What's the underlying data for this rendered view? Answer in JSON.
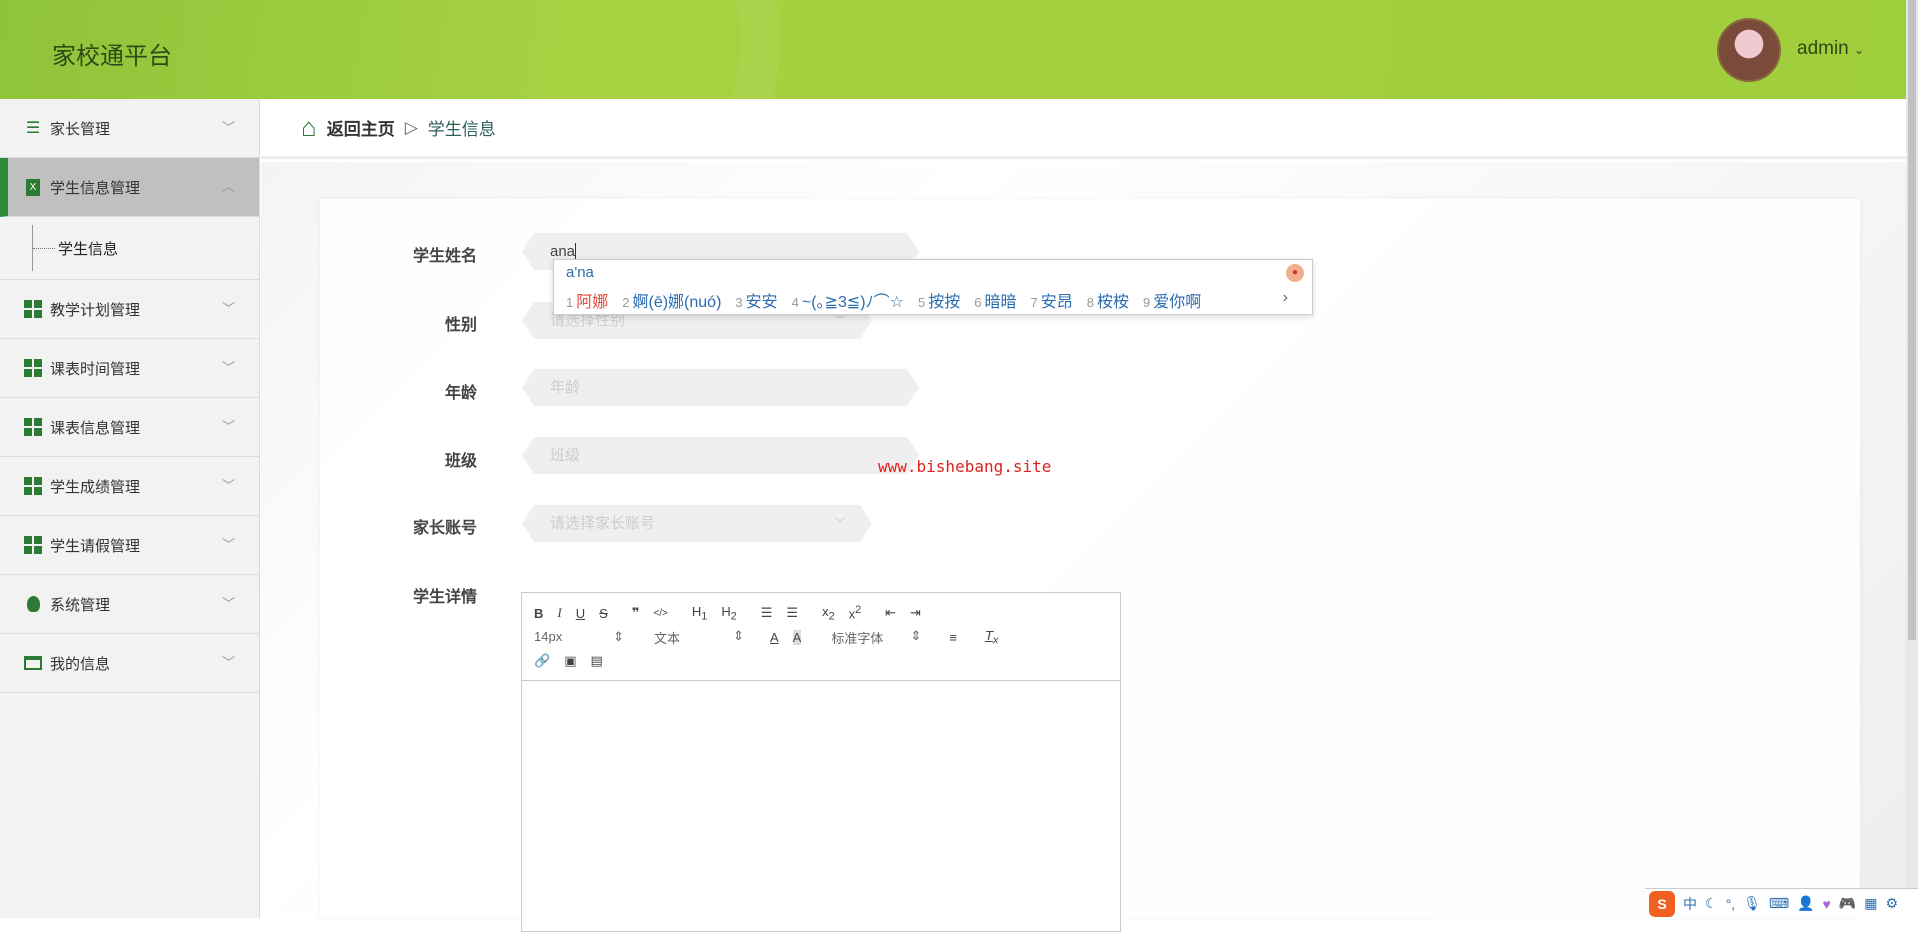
{
  "header": {
    "title": "家校通平台",
    "user": "admin"
  },
  "sidebar": {
    "items": [
      {
        "label": "家长管理",
        "icon": "list-icon"
      },
      {
        "label": "学生信息管理",
        "icon": "clipboard-icon",
        "active": true
      },
      {
        "label": "教学计划管理",
        "icon": "grid-icon"
      },
      {
        "label": "课表时间管理",
        "icon": "grid-icon"
      },
      {
        "label": "课表信息管理",
        "icon": "grid-icon"
      },
      {
        "label": "学生成绩管理",
        "icon": "grid-icon"
      },
      {
        "label": "学生请假管理",
        "icon": "grid-icon"
      },
      {
        "label": "系统管理",
        "icon": "bulb-icon"
      },
      {
        "label": "我的信息",
        "icon": "card-icon"
      }
    ],
    "sub_item": "学生信息"
  },
  "breadcrumb": {
    "home": "返回主页",
    "sep": "▷",
    "current": "学生信息"
  },
  "form": {
    "name": {
      "label": "学生姓名",
      "value": "ana"
    },
    "gender": {
      "label": "性别",
      "placeholder": "请选择性别"
    },
    "age": {
      "label": "年龄",
      "placeholder": "年龄"
    },
    "class": {
      "label": "班级",
      "placeholder": "班级"
    },
    "parent": {
      "label": "家长账号",
      "placeholder": "请选择家长账号"
    },
    "detail": {
      "label": "学生详情"
    }
  },
  "editor": {
    "font_size": "14px",
    "heading": "文本",
    "font_family": "标准字体"
  },
  "ime": {
    "pinyin": "a'na",
    "candidates": [
      {
        "n": "1",
        "w": "阿娜"
      },
      {
        "n": "2",
        "w": "婀(ē)娜(nuó)"
      },
      {
        "n": "3",
        "w": "安安"
      },
      {
        "n": "4",
        "w": "~(｡≧3≦)ﾉ⌒☆"
      },
      {
        "n": "5",
        "w": "按按"
      },
      {
        "n": "6",
        "w": "暗暗"
      },
      {
        "n": "7",
        "w": "安昂"
      },
      {
        "n": "8",
        "w": "桉桉"
      },
      {
        "n": "9",
        "w": "爱你啊"
      }
    ],
    "more": "›"
  },
  "watermark": "www.bishebang.site",
  "tray": {
    "logo": "S",
    "mode": "中"
  }
}
